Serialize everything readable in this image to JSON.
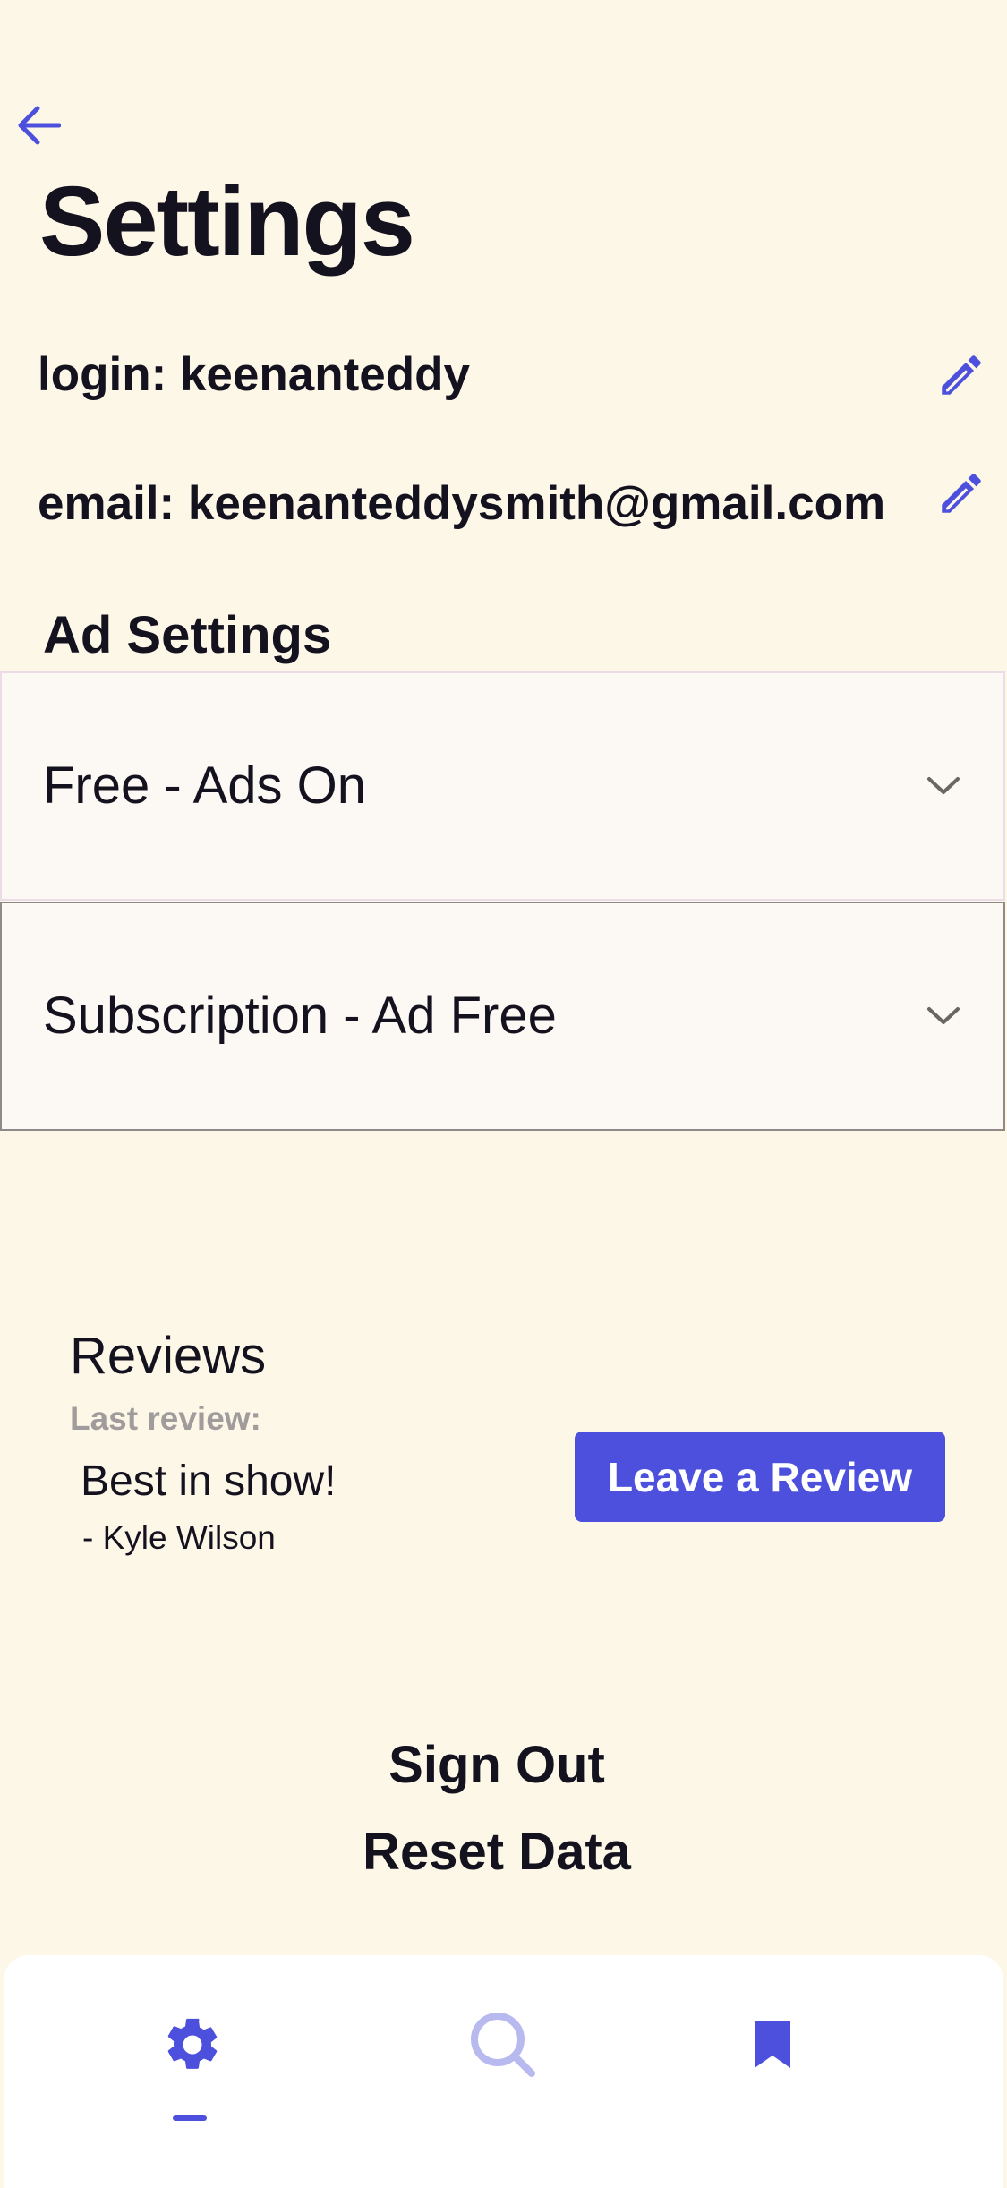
{
  "header": {
    "title": "Settings"
  },
  "account": {
    "login": "login: keenanteddy",
    "email": "email: keenanteddysmith@gmail.com"
  },
  "ad_settings": {
    "heading": "Ad Settings",
    "options": [
      {
        "label": "Free - Ads On"
      },
      {
        "label": "Subscription - Ad Free"
      }
    ]
  },
  "reviews": {
    "title": "Reviews",
    "last_review_label": "Last review:",
    "quote": "Best in show!",
    "author": "- Kyle Wilson",
    "leave_review_label": "Leave a Review"
  },
  "actions": {
    "sign_out": "Sign Out",
    "reset_data": "Reset Data"
  },
  "bottom_nav": {
    "items": [
      {
        "icon": "gear-icon",
        "active": true
      },
      {
        "icon": "search-icon",
        "active": false
      },
      {
        "icon": "bookmark-icon",
        "active": false
      }
    ],
    "active_color": "#4d50dc",
    "inactive_color": "#b8b9ef"
  },
  "colors": {
    "background": "#fdf7e8",
    "accent": "#4d50dc",
    "text": "#15121f",
    "muted": "#a09c9c"
  }
}
